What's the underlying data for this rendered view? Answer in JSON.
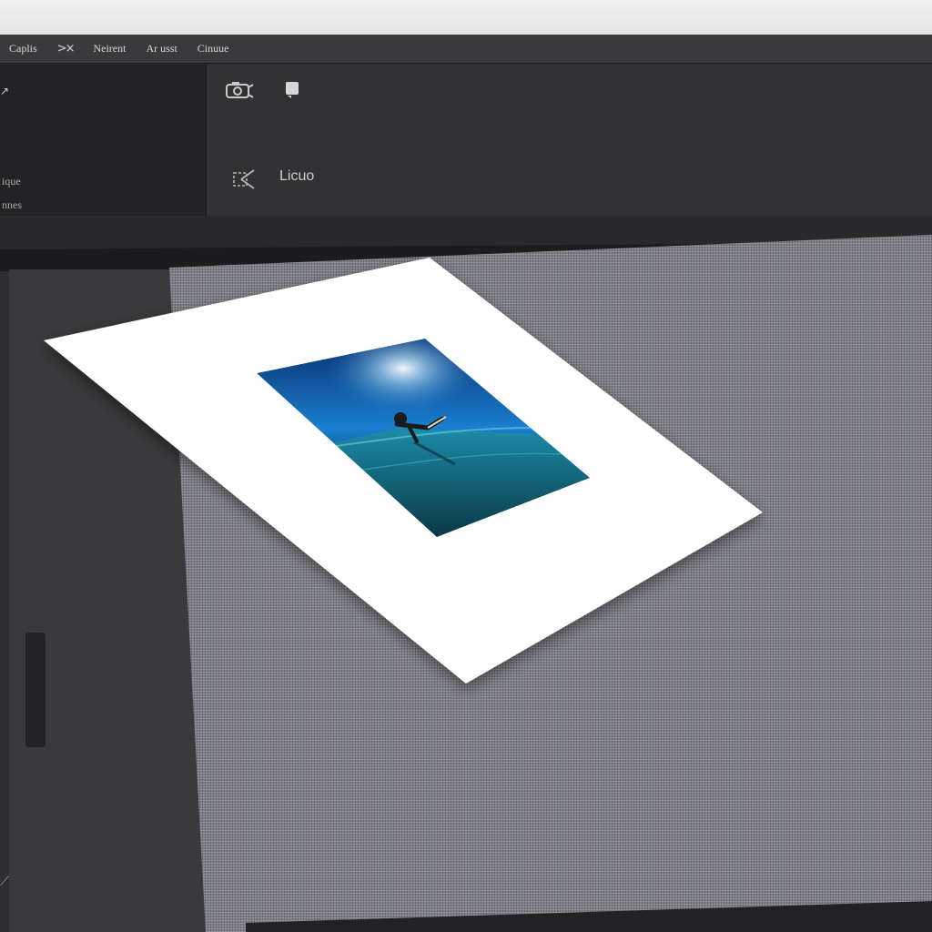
{
  "menubar": {
    "items": [
      "Caplis",
      "Neirent",
      "Ar usst",
      "Cinuue"
    ]
  },
  "left_panel": {
    "labels": [
      "ique",
      "nnes"
    ]
  },
  "toolbar": {
    "label": "Licuo",
    "icons": [
      "camera-icon",
      "square-icon",
      "transform-icon"
    ]
  },
  "canvas": {
    "document": "white-page-with-ocean-photo",
    "photo_subject": "diver-underwater-icon"
  },
  "colors": {
    "ui_dark": "#2b2b2d",
    "panel": "#3a3a3c",
    "canvas_gray": "#7d7e86",
    "ocean_blue": "#0b5f9c"
  }
}
